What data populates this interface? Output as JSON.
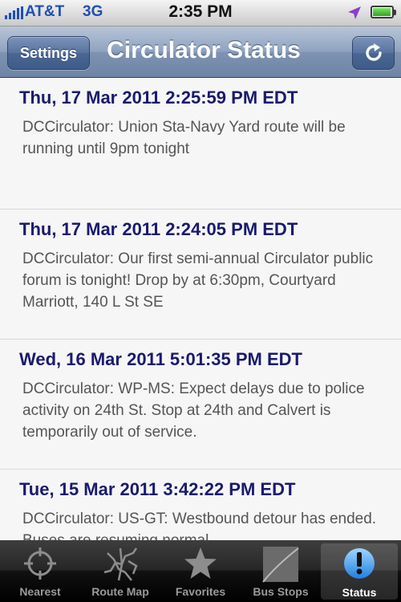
{
  "status_bar": {
    "carrier": "AT&T",
    "network": "3G",
    "time": "2:35 PM",
    "battery_level": 0.95
  },
  "nav": {
    "title": "Circulator Status",
    "settings_label": "Settings",
    "refresh_icon": "refresh-icon"
  },
  "messages": [
    {
      "date": "Thu, 17 Mar 2011 2:25:59 PM EDT",
      "text": "DCCirculator: Union Sta-Navy Yard route will be running until 9pm tonight"
    },
    {
      "date": "Thu, 17 Mar 2011 2:24:05 PM EDT",
      "text": "DCCirculator: Our first semi-annual Circulator public forum is tonight! Drop by at 6:30pm, Courtyard Marriott, 140 L St SE"
    },
    {
      "date": "Wed, 16 Mar 2011 5:01:35 PM EDT",
      "text": "DCCirculator: WP-MS: Expect delays due to police activity on 24th St. Stop at 24th and Calvert is temporarily out of service."
    },
    {
      "date": "Tue, 15 Mar 2011 3:42:22 PM EDT",
      "text": "DCCirculator: US-GT: Westbound detour has ended. Buses are resuming normal"
    }
  ],
  "tabs": [
    {
      "label": "Nearest",
      "icon": "crosshair-icon"
    },
    {
      "label": "Route Map",
      "icon": "route-map-icon"
    },
    {
      "label": "Favorites",
      "icon": "star-icon"
    },
    {
      "label": "Bus Stops",
      "icon": "bus-stops-icon"
    },
    {
      "label": "Status",
      "icon": "exclamation-icon",
      "selected": true
    }
  ],
  "colors": {
    "date_text": "#1a1a6e",
    "body_text": "#555555",
    "carrier_blue": "#1e4fb5"
  }
}
